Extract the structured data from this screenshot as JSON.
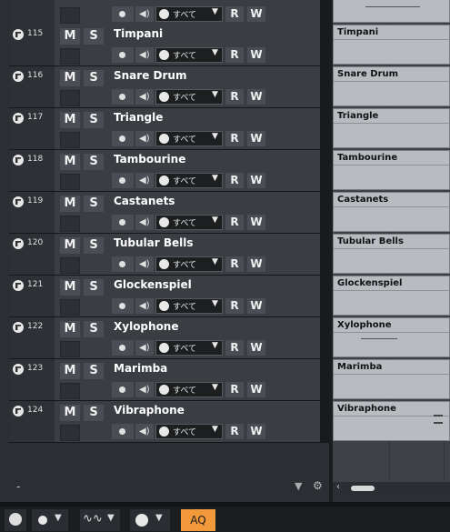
{
  "tracks": [
    {
      "num": "115",
      "name": "Timpani"
    },
    {
      "num": "116",
      "name": "Snare Drum"
    },
    {
      "num": "117",
      "name": "Triangle"
    },
    {
      "num": "118",
      "name": "Tambourine"
    },
    {
      "num": "119",
      "name": "Castanets"
    },
    {
      "num": "120",
      "name": "Tubular Bells"
    },
    {
      "num": "121",
      "name": "Glockenspiel"
    },
    {
      "num": "122",
      "name": "Xylophone"
    },
    {
      "num": "123",
      "name": "Marimba"
    },
    {
      "num": "124",
      "name": "Vibraphone"
    }
  ],
  "labels": {
    "mute": "M",
    "solo": "S",
    "read": "R",
    "write": "W",
    "input_all": "すべて",
    "dropdown_arrow": "▼"
  },
  "bottom": {
    "dash": "-"
  },
  "status": {
    "aq": "AQ"
  },
  "icons": {
    "record": "record-enable-icon",
    "monitor": "monitor-icon",
    "speaker": "speaker-icon",
    "midi": "midi-input-icon",
    "gear": "gear-icon",
    "down": "triangle-down-icon"
  },
  "colors": {
    "aq_accent": "#f29a3b",
    "clip_bg": "#b8bcc0"
  }
}
